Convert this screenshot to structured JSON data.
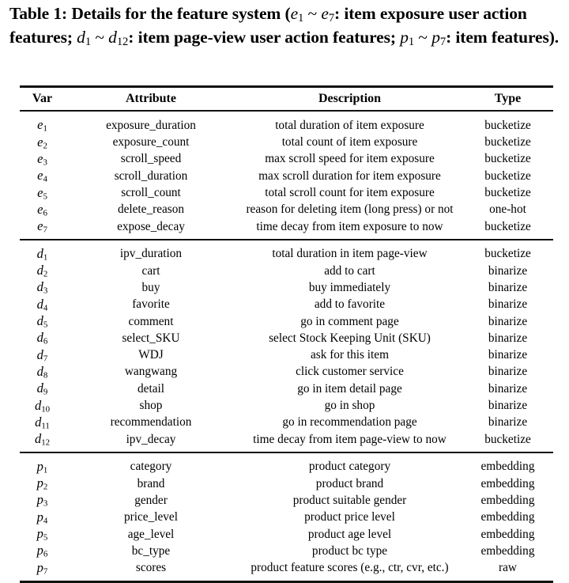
{
  "caption": {
    "prefix": "Table 1: Details for the feature system (",
    "seg1_var_a": "e",
    "seg1_sub_a": "1",
    "tilde": "~",
    "seg1_var_b": "e",
    "seg1_sub_b": "7",
    "seg1_text": ": item exposure user action features; ",
    "seg2_var_a": "d",
    "seg2_sub_a": "1",
    "seg2_var_b": "d",
    "seg2_sub_b": "12",
    "seg2_text": ": item page-view user action features; ",
    "seg3_var_a": "p",
    "seg3_sub_a": "1",
    "seg3_var_b": "p",
    "seg3_sub_b": "7",
    "seg3_text": ": item features)."
  },
  "table": {
    "columns": [
      "Var",
      "Attribute",
      "Description",
      "Type"
    ],
    "sections": [
      {
        "id": "exposure",
        "rows": [
          {
            "var_sym": "e",
            "var_sub": "1",
            "attribute": "exposure_duration",
            "description": "total duration of item exposure",
            "type": "bucketize"
          },
          {
            "var_sym": "e",
            "var_sub": "2",
            "attribute": "exposure_count",
            "description": "total count of item exposure",
            "type": "bucketize"
          },
          {
            "var_sym": "e",
            "var_sub": "3",
            "attribute": "scroll_speed",
            "description": "max scroll speed for item exposure",
            "type": "bucketize"
          },
          {
            "var_sym": "e",
            "var_sub": "4",
            "attribute": "scroll_duration",
            "description": "max scroll duration for item exposure",
            "type": "bucketize"
          },
          {
            "var_sym": "e",
            "var_sub": "5",
            "attribute": "scroll_count",
            "description": "total scroll count for item exposure",
            "type": "bucketize"
          },
          {
            "var_sym": "e",
            "var_sub": "6",
            "attribute": "delete_reason",
            "description": "reason for deleting item (long press) or not",
            "type": "one-hot"
          },
          {
            "var_sym": "e",
            "var_sub": "7",
            "attribute": "expose_decay",
            "description": "time decay from item exposure to now",
            "type": "bucketize"
          }
        ]
      },
      {
        "id": "page-view",
        "rows": [
          {
            "var_sym": "d",
            "var_sub": "1",
            "attribute": "ipv_duration",
            "description": "total duration in item page-view",
            "type": "bucketize"
          },
          {
            "var_sym": "d",
            "var_sub": "2",
            "attribute": "cart",
            "description": "add to cart",
            "type": "binarize"
          },
          {
            "var_sym": "d",
            "var_sub": "3",
            "attribute": "buy",
            "description": "buy immediately",
            "type": "binarize"
          },
          {
            "var_sym": "d",
            "var_sub": "4",
            "attribute": "favorite",
            "description": "add to favorite",
            "type": "binarize"
          },
          {
            "var_sym": "d",
            "var_sub": "5",
            "attribute": "comment",
            "description": "go in comment page",
            "type": "binarize"
          },
          {
            "var_sym": "d",
            "var_sub": "6",
            "attribute": "select_SKU",
            "description": "select Stock Keeping Unit (SKU)",
            "type": "binarize"
          },
          {
            "var_sym": "d",
            "var_sub": "7",
            "attribute": "WDJ",
            "description": "ask for this item",
            "type": "binarize"
          },
          {
            "var_sym": "d",
            "var_sub": "8",
            "attribute": "wangwang",
            "description": "click customer service",
            "type": "binarize"
          },
          {
            "var_sym": "d",
            "var_sub": "9",
            "attribute": "detail",
            "description": "go in item detail page",
            "type": "binarize"
          },
          {
            "var_sym": "d",
            "var_sub": "10",
            "attribute": "shop",
            "description": "go in shop",
            "type": "binarize"
          },
          {
            "var_sym": "d",
            "var_sub": "11",
            "attribute": "recommendation",
            "description": "go in recommendation page",
            "type": "binarize"
          },
          {
            "var_sym": "d",
            "var_sub": "12",
            "attribute": "ipv_decay",
            "description": "time decay from item page-view to now",
            "type": "bucketize"
          }
        ]
      },
      {
        "id": "item",
        "rows": [
          {
            "var_sym": "p",
            "var_sub": "1",
            "attribute": "category",
            "description": "product category",
            "type": "embedding"
          },
          {
            "var_sym": "p",
            "var_sub": "2",
            "attribute": "brand",
            "description": "product brand",
            "type": "embedding"
          },
          {
            "var_sym": "p",
            "var_sub": "3",
            "attribute": "gender",
            "description": "product suitable gender",
            "type": "embedding"
          },
          {
            "var_sym": "p",
            "var_sub": "4",
            "attribute": "price_level",
            "description": "product price level",
            "type": "embedding"
          },
          {
            "var_sym": "p",
            "var_sub": "5",
            "attribute": "age_level",
            "description": "product age level",
            "type": "embedding"
          },
          {
            "var_sym": "p",
            "var_sub": "6",
            "attribute": "bc_type",
            "description": "product bc type",
            "type": "embedding"
          },
          {
            "var_sym": "p",
            "var_sub": "7",
            "attribute": "scores",
            "description": "product feature scores (e.g., ctr, cvr, etc.)",
            "type": "raw"
          }
        ]
      }
    ]
  }
}
